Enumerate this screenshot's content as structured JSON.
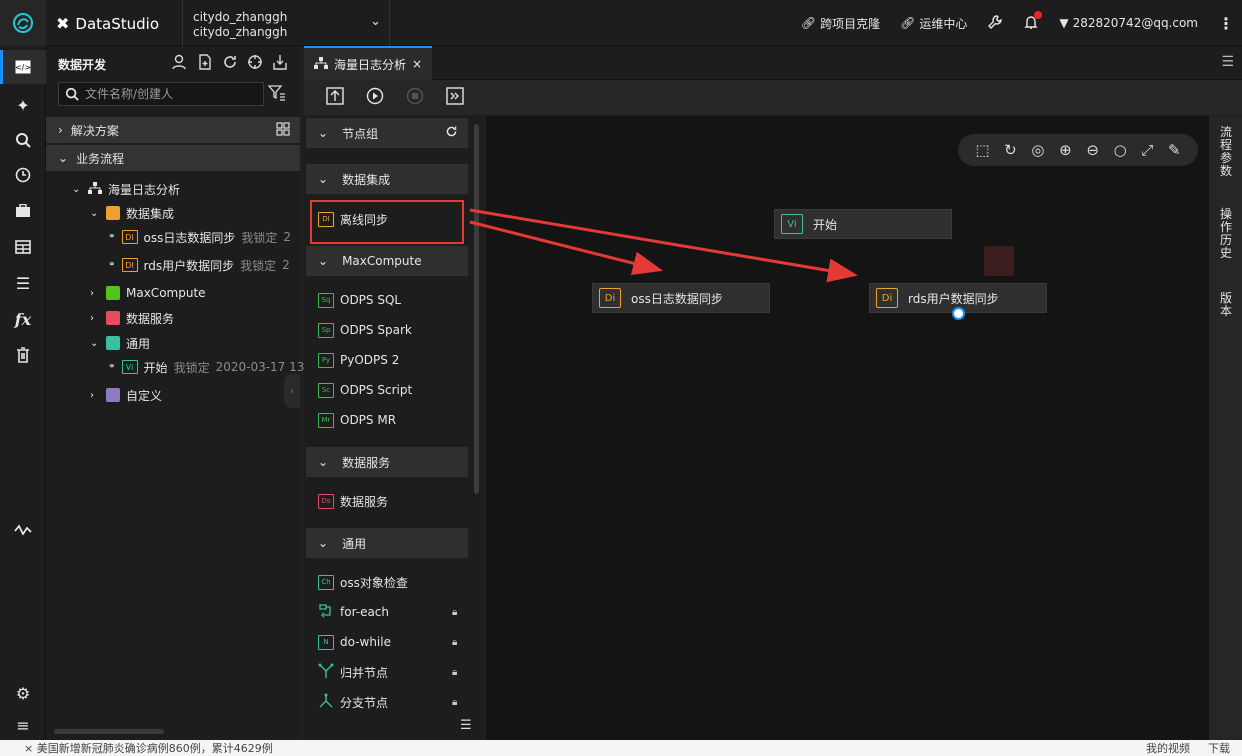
{
  "topbar": {
    "brand": "DataStudio",
    "project_line1": "citydo_zhanggh",
    "project_line2": "citydo_zhanggh",
    "links": [
      "跨项目克隆",
      "运维中心"
    ],
    "user": "282820742@qq.com"
  },
  "explorer": {
    "title": "数据开发",
    "search_placeholder": "文件名称/创建人",
    "sections": {
      "solutions": "解决方案",
      "business_flow": "业务流程"
    },
    "tree": {
      "flow": "海量日志分析",
      "integration": "数据集成",
      "task1": "oss日志数据同步",
      "task1_lock": "我锁定",
      "task1_trunc": "2",
      "task2": "rds用户数据同步",
      "task2_lock": "我锁定",
      "task2_trunc": "2",
      "maxcompute": "MaxCompute",
      "data_service": "数据服务",
      "general": "通用",
      "start": "开始",
      "start_lock": "我锁定",
      "start_time": "2020-03-17 13",
      "custom": "自定义"
    }
  },
  "tabs": {
    "active": "海量日志分析",
    "close": "×"
  },
  "node_panel": {
    "groups": [
      "节点组",
      "数据集成",
      "MaxCompute",
      "数据服务",
      "通用"
    ],
    "items": {
      "offline_sync": "离线同步",
      "odps_sql": "ODPS SQL",
      "odps_spark": "ODPS Spark",
      "pyodps": "PyODPS 2",
      "odps_script": "ODPS Script",
      "odps_mr": "ODPS MR",
      "data_service": "数据服务",
      "oss_check": "oss对象检查",
      "for_each": "for-each",
      "do_while": "do-while",
      "merge": "归并节点",
      "branch": "分支节点"
    },
    "badges": {
      "di": "DI",
      "sq": "Sq",
      "sp": "Sp",
      "py": "Py",
      "sc": "Sc",
      "mr": "Mr",
      "ds": "Ds",
      "ch": "Ch",
      "n": "N"
    }
  },
  "canvas": {
    "nodes": {
      "start": {
        "badge": "Vi",
        "label": "开始"
      },
      "oss": {
        "badge": "Di",
        "label": "oss日志数据同步"
      },
      "rds": {
        "badge": "Di",
        "label": "rds用户数据同步"
      }
    }
  },
  "right_rail": [
    "流程参数",
    "操作历史",
    "版本"
  ],
  "statusbar": {
    "news": "× 美国新增新冠肺炎确诊病例860例，累计4629例",
    "right_items": [
      "我的视频",
      "下载"
    ]
  },
  "colors": {
    "accent": "#1890ff",
    "highlight": "#e53935",
    "di": "#f0a030",
    "vi": "#3ac0a0"
  }
}
